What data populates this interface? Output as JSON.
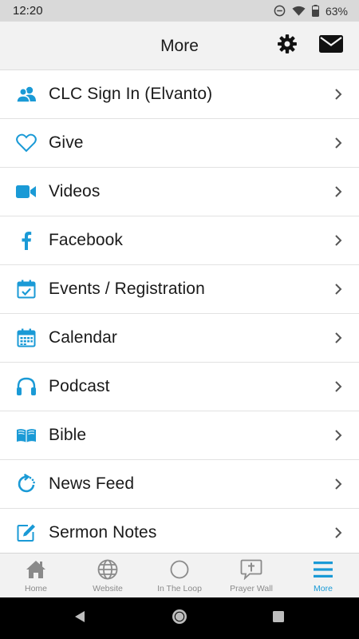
{
  "status": {
    "time": "12:20",
    "battery": "63%"
  },
  "header": {
    "title": "More",
    "settings_icon": "gear-icon",
    "mail_icon": "mail-icon"
  },
  "colors": {
    "accent": "#1a9ad6",
    "header_bg": "#f2f2f2",
    "status_bg": "#d9d9d9"
  },
  "menu": {
    "items": [
      {
        "label": "CLC Sign In (Elvanto)",
        "icon": "users-icon"
      },
      {
        "label": "Give",
        "icon": "heart-icon"
      },
      {
        "label": "Videos",
        "icon": "video-camera-icon"
      },
      {
        "label": "Facebook",
        "icon": "facebook-icon"
      },
      {
        "label": "Events / Registration",
        "icon": "calendar-check-icon"
      },
      {
        "label": "Calendar",
        "icon": "calendar-icon"
      },
      {
        "label": "Podcast",
        "icon": "headphones-icon"
      },
      {
        "label": "Bible",
        "icon": "open-book-icon"
      },
      {
        "label": "News Feed",
        "icon": "refresh-feed-icon"
      },
      {
        "label": "Sermon Notes",
        "icon": "edit-note-icon"
      }
    ]
  },
  "tabs": [
    {
      "label": "Home",
      "icon": "home-icon",
      "active": false
    },
    {
      "label": "Website",
      "icon": "globe-icon",
      "active": false
    },
    {
      "label": "In The Loop",
      "icon": "circle-icon",
      "active": false
    },
    {
      "label": "Prayer Wall",
      "icon": "prayer-bubble-icon",
      "active": false
    },
    {
      "label": "More",
      "icon": "menu-icon",
      "active": true
    }
  ]
}
